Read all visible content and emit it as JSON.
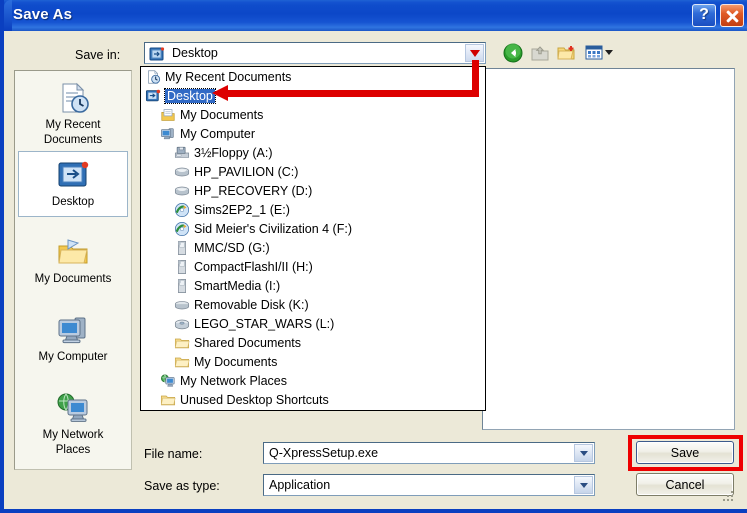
{
  "window": {
    "title": "Save As",
    "help_button": "?",
    "close_button": "✕",
    "accent_titlebar": "#0c47c8",
    "body_color": "#ece9d8"
  },
  "toolbar": {
    "save_in_label": "Save in:",
    "save_in_value": "Desktop",
    "icons": [
      {
        "name": "back-icon",
        "label": "Back"
      },
      {
        "name": "up-one-level-icon",
        "label": "Up One Level"
      },
      {
        "name": "create-new-folder-icon",
        "label": "Create New Folder"
      },
      {
        "name": "views-icon",
        "label": "Views"
      }
    ]
  },
  "places": [
    {
      "label_line1": "My Recent",
      "label_line2": "Documents",
      "icon": "recent-documents-icon",
      "selected": false
    },
    {
      "label_line1": "Desktop",
      "label_line2": "",
      "icon": "desktop-icon",
      "selected": true
    },
    {
      "label_line1": "My Documents",
      "label_line2": "",
      "icon": "my-documents-icon",
      "selected": false
    },
    {
      "label_line1": "My Computer",
      "label_line2": "",
      "icon": "my-computer-icon",
      "selected": false
    },
    {
      "label_line1": "My Network",
      "label_line2": "Places",
      "icon": "my-network-places-icon",
      "selected": false
    }
  ],
  "dropdown": {
    "items": [
      {
        "label": "My Recent Documents",
        "icon": "recent-documents-icon",
        "indent": 0,
        "selected": false
      },
      {
        "label": "Desktop",
        "icon": "desktop-icon",
        "indent": 0,
        "selected": true
      },
      {
        "label": "My Documents",
        "icon": "my-documents-icon",
        "indent": 1,
        "selected": false
      },
      {
        "label": "My Computer",
        "icon": "my-computer-icon",
        "indent": 1,
        "selected": false
      },
      {
        "label": "3½Floppy (A:)",
        "icon": "floppy-drive-icon",
        "indent": 2,
        "selected": false
      },
      {
        "label": "HP_PAVILION (C:)",
        "icon": "hard-drive-icon",
        "indent": 2,
        "selected": false
      },
      {
        "label": "HP_RECOVERY (D:)",
        "icon": "hard-drive-icon",
        "indent": 2,
        "selected": false
      },
      {
        "label": "Sims2EP2_1 (E:)",
        "icon": "cd-drive-game-icon",
        "indent": 2,
        "selected": false
      },
      {
        "label": "Sid Meier's Civilization 4 (F:)",
        "icon": "cd-drive-game-icon",
        "indent": 2,
        "selected": false
      },
      {
        "label": "MMC/SD (G:)",
        "icon": "memory-card-icon",
        "indent": 2,
        "selected": false
      },
      {
        "label": "CompactFlashI/II (H:)",
        "icon": "memory-card-icon",
        "indent": 2,
        "selected": false
      },
      {
        "label": "SmartMedia (I:)",
        "icon": "memory-card-icon",
        "indent": 2,
        "selected": false
      },
      {
        "label": "Removable Disk (K:)",
        "icon": "removable-disk-icon",
        "indent": 2,
        "selected": false
      },
      {
        "label": "LEGO_STAR_WARS (L:)",
        "icon": "cd-drive-icon",
        "indent": 2,
        "selected": false
      },
      {
        "label": "Shared Documents",
        "icon": "folder-icon",
        "indent": 2,
        "selected": false
      },
      {
        "label": "My Documents",
        "icon": "folder-icon",
        "indent": 2,
        "selected": false
      },
      {
        "label": "My Network Places",
        "icon": "my-network-places-icon",
        "indent": 1,
        "selected": false
      },
      {
        "label": "Unused Desktop Shortcuts",
        "icon": "folder-icon",
        "indent": 1,
        "selected": false
      }
    ]
  },
  "form": {
    "file_name_label": "File name:",
    "file_name_value": "Q-XpressSetup.exe",
    "save_as_type_label": "Save as type:",
    "save_as_type_value": "Application",
    "save_button": "Save",
    "cancel_button": "Cancel"
  },
  "annotations": {
    "highlight_color": "#ee0000",
    "arrow_color": "#dd0000",
    "arrow_target": "Desktop",
    "highlight_target": "Save"
  }
}
